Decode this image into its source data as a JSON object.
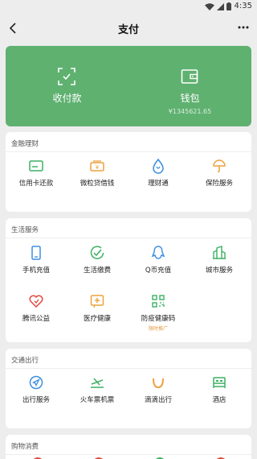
{
  "status": {
    "time": "4:35"
  },
  "nav": {
    "title": "支付"
  },
  "pay": {
    "receive_label": "收付款",
    "wallet_label": "钱包",
    "wallet_balance": "¥1345621.65"
  },
  "sections": {
    "finance": {
      "title": "金融理财",
      "items": [
        "信用卡还款",
        "微粒贷借钱",
        "理财通",
        "保险服务"
      ]
    },
    "life": {
      "title": "生活服务",
      "items": [
        "手机充值",
        "生活缴费",
        "Q币充值",
        "城市服务",
        "腾讯公益",
        "医疗健康",
        "防疫健康码"
      ],
      "tag": "限时推广"
    },
    "travel": {
      "title": "交通出行",
      "items": [
        "出行服务",
        "火车票机票",
        "滴滴出行",
        "酒店"
      ]
    },
    "shopping": {
      "title": "购物消费"
    }
  },
  "colors": {
    "brand_green": "#5fb170",
    "icon_green": "#3cb063",
    "icon_orange": "#eea13c",
    "icon_blue": "#3d8fe0",
    "icon_red": "#e2493f"
  }
}
